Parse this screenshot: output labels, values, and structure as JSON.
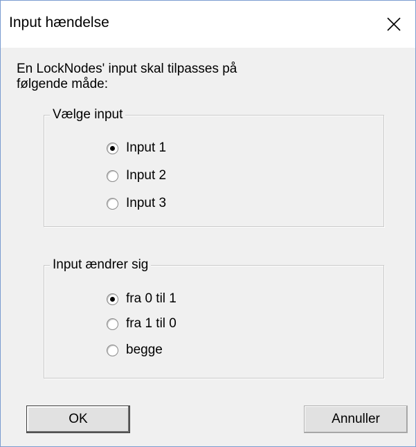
{
  "window": {
    "title": "Input hændelse",
    "close_icon": "close-x-icon"
  },
  "description": "En LockNodes' input skal tilpasses på\nfølgende måde:",
  "select_input_group": {
    "legend": "Vælge input",
    "options": [
      {
        "label": "Input 1",
        "selected": true
      },
      {
        "label": "Input 2",
        "selected": false
      },
      {
        "label": "Input 3",
        "selected": false
      }
    ]
  },
  "input_change_group": {
    "legend": "Input ændrer sig",
    "options": [
      {
        "label": "fra 0 til 1",
        "selected": true
      },
      {
        "label": "fra 1 til 0",
        "selected": false
      },
      {
        "label": "begge",
        "selected": false
      }
    ]
  },
  "buttons": {
    "ok_label": "OK",
    "cancel_label": "Annuller"
  }
}
